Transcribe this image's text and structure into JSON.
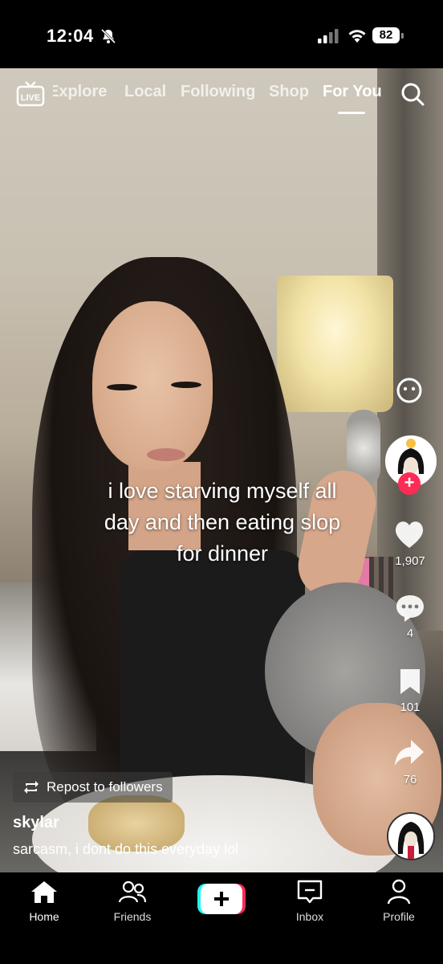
{
  "status_bar": {
    "time": "12:04",
    "battery": "82"
  },
  "top_nav": {
    "tabs": [
      {
        "label": "Explore"
      },
      {
        "label": "Local"
      },
      {
        "label": "Following"
      },
      {
        "label": "Shop"
      },
      {
        "label": "For You",
        "active": true
      }
    ],
    "live_label": "LIVE"
  },
  "video": {
    "caption_lines": [
      "i love starving myself all",
      "day and then eating slop",
      "for dinner"
    ]
  },
  "side_actions": {
    "likes": "1,907",
    "comments": "4",
    "bookmarks": "101",
    "shares": "76"
  },
  "post": {
    "repost_label": "Repost to followers",
    "username": "skylar",
    "description": "sarcasm, i dont do this everyday lol"
  },
  "bottom_nav": {
    "items": [
      {
        "label": "Home"
      },
      {
        "label": "Friends"
      },
      {
        "label": ""
      },
      {
        "label": "Inbox"
      },
      {
        "label": "Profile"
      }
    ]
  },
  "colors": {
    "accent": "#fe2c55",
    "cyan": "#25f4ee"
  }
}
